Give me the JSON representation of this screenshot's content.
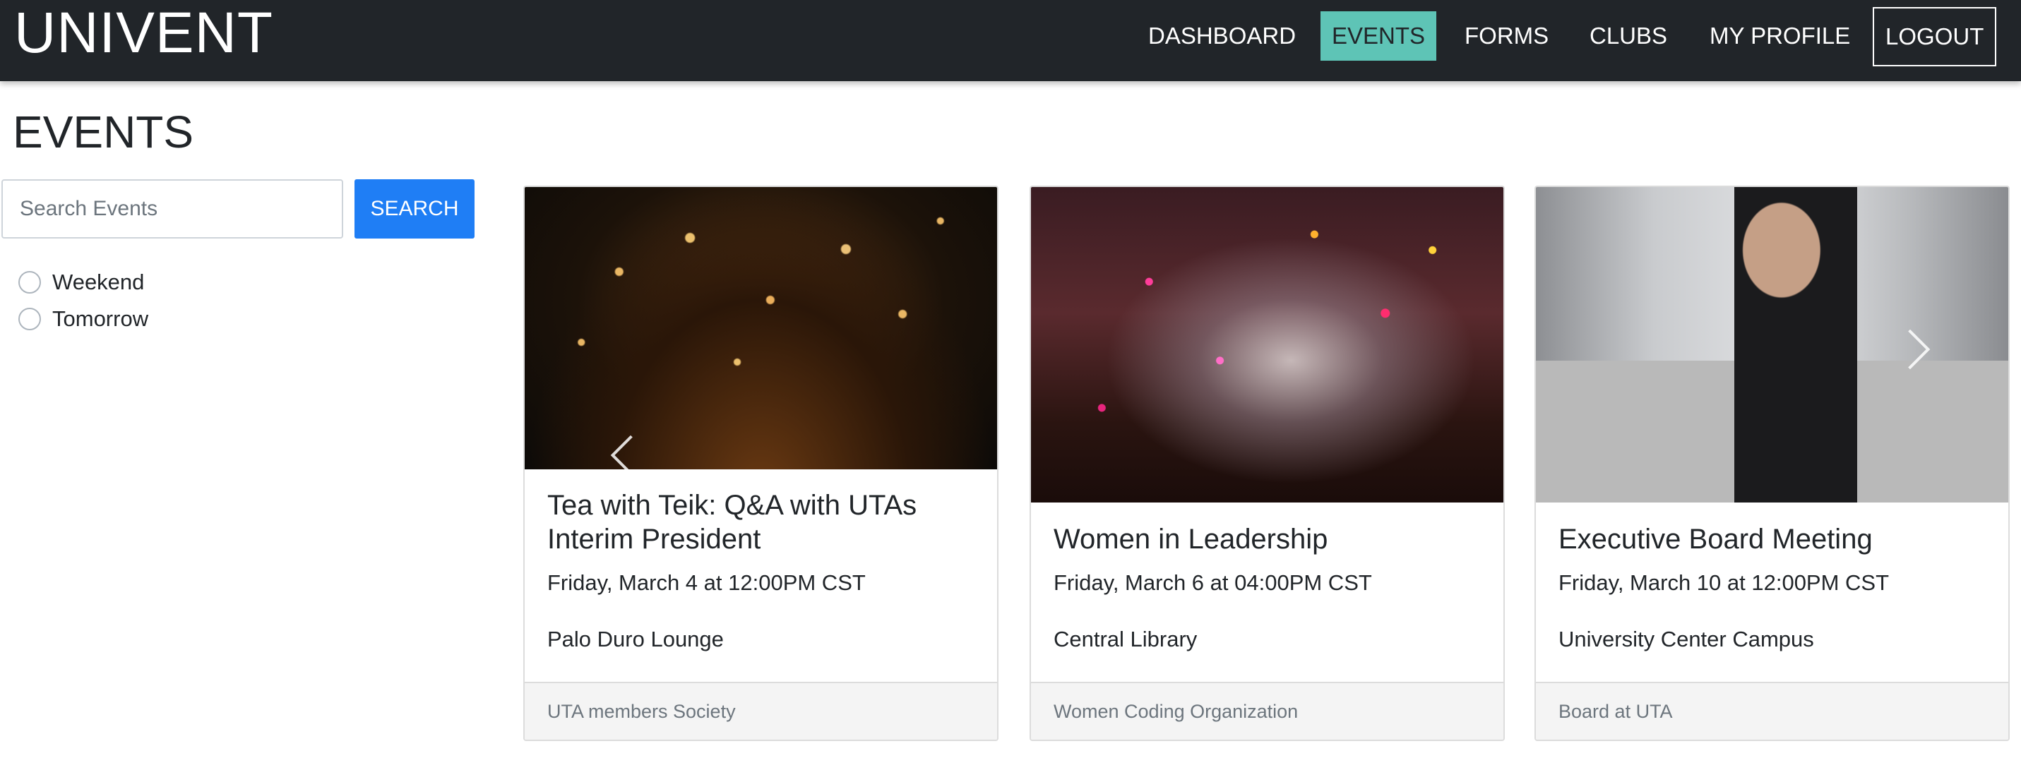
{
  "navbar": {
    "brand": "UNIVENT",
    "items": [
      {
        "label": "DASHBOARD",
        "active": false
      },
      {
        "label": "EVENTS",
        "active": true
      },
      {
        "label": "FORMS",
        "active": false
      },
      {
        "label": "CLUBS",
        "active": false
      },
      {
        "label": "MY PROFILE",
        "active": false
      }
    ],
    "logout_label": "LOGOUT"
  },
  "page": {
    "title": "EVENTS"
  },
  "search": {
    "placeholder": "Search Events",
    "value": "",
    "button_label": "SEARCH"
  },
  "filters": [
    {
      "label": "Weekend",
      "checked": false
    },
    {
      "label": "Tomorrow",
      "checked": false
    }
  ],
  "events": [
    {
      "title": "Tea with Teik: Q&A with UTAs Interim President",
      "date": "Friday, March 4 at 12:00PM CST",
      "location": "Palo Duro Lounge",
      "organizer": "UTA members Society",
      "image": "lanterns-photo"
    },
    {
      "title": "Women in Leadership",
      "date": "Friday, March 6 at 04:00PM CST",
      "location": "Central Library",
      "organizer": "Women Coding Organization",
      "image": "confetti-photo"
    },
    {
      "title": "Executive Board Meeting",
      "date": "Friday, March 10 at 12:00PM CST",
      "location": "University Center Campus",
      "organizer": "Board at UTA",
      "image": "street-portrait-photo"
    }
  ],
  "colors": {
    "navbar_bg": "#212529",
    "active_nav": "#5ec4b6",
    "search_button": "#1f7ef5"
  }
}
